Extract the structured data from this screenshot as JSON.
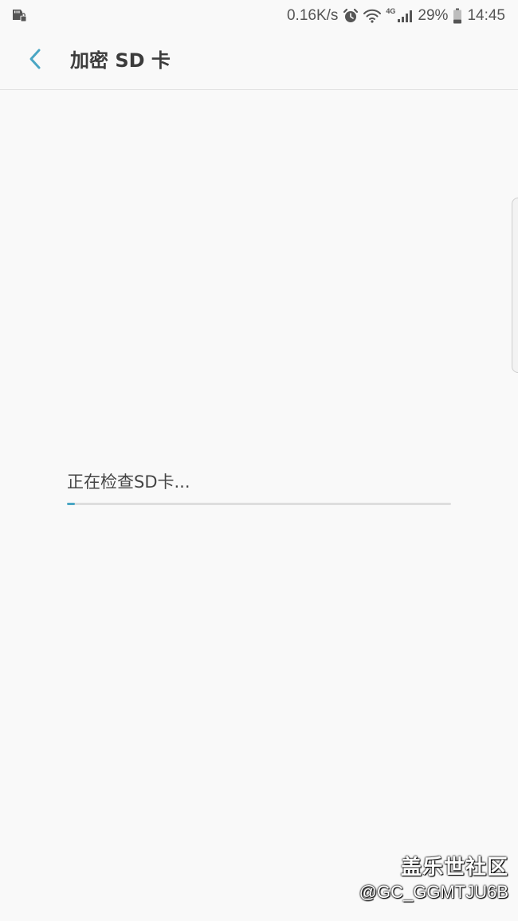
{
  "status_bar": {
    "left_icon": "sd-card-lock-icon",
    "net_speed": "0.16K/s",
    "alarm_icon": "alarm-clock-icon",
    "wifi_icon": "wifi-icon",
    "network_type": "4G",
    "signal_icon": "signal-bars-icon",
    "battery_percent": "29%",
    "battery_level": 0.29,
    "battery_icon": "battery-icon",
    "time": "14:45"
  },
  "app_bar": {
    "back_icon": "back-arrow-icon",
    "title": "加密 SD 卡"
  },
  "progress": {
    "label": "正在检查SD卡...",
    "fraction": 0.02
  },
  "watermark": {
    "line1": "盖乐世社区",
    "line2": "@GC_GGMTJU6B"
  },
  "colors": {
    "background": "#f9f9f9",
    "accent": "#4aa6c4",
    "progress_track": "#dedede",
    "title": "#3c3c3c"
  }
}
